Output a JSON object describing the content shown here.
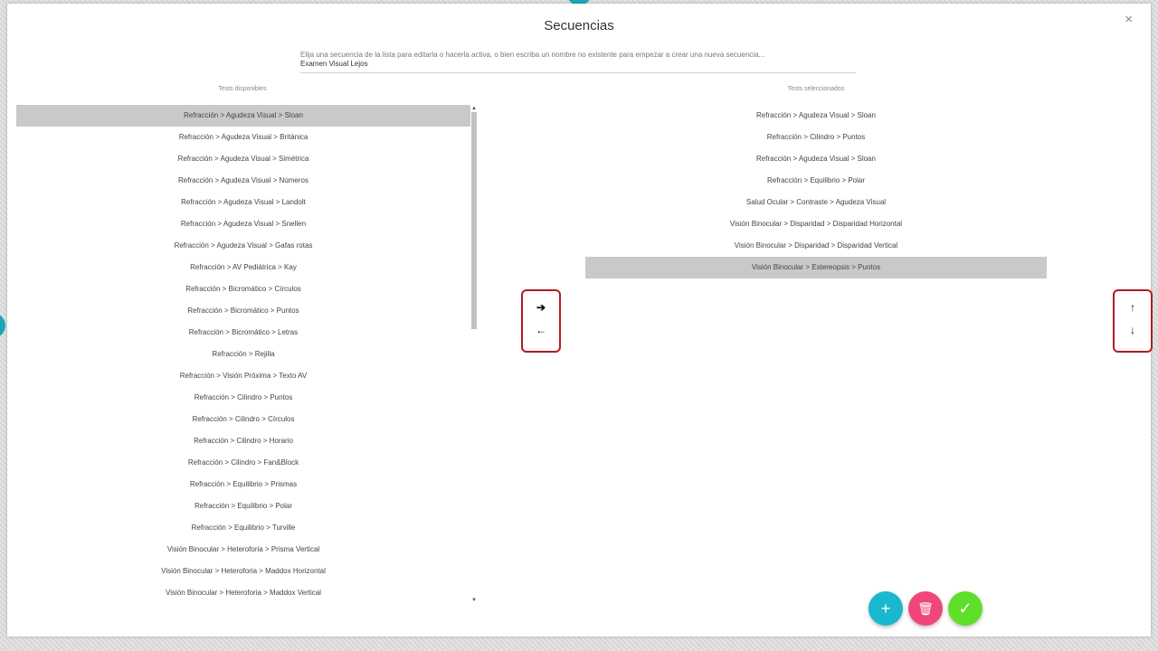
{
  "dialog": {
    "title": "Secuencias",
    "close_icon": "×"
  },
  "sequence": {
    "placeholder": "Elija una secuencia de la lista para editarla o hacerla activa, o bien escriba un nombre no existente para empezar a crear una nueva secuencia...",
    "value": "Examen Visual Lejos"
  },
  "available": {
    "label": "Tests disponibles",
    "selected_index": 0,
    "items": [
      "Refracción > Agudeza Visual > Sloan",
      "Refracción > Agudeza Visual > Británica",
      "Refracción > Agudeza Visual > Simétrica",
      "Refracción > Agudeza Visual > Números",
      "Refracción > Agudeza Visual > Landolt",
      "Refracción > Agudeza Visual > Snellen",
      "Refracción > Agudeza Visual > Gafas rotas",
      "Refracción > AV Pediátrica > Kay",
      "Refracción > Bicromático > Círculos",
      "Refracción > Bicromático > Puntos",
      "Refracción > Bicromático > Letras",
      "Refracción > Rejilla",
      "Refracción > Visión Próxima > Texto AV",
      "Refracción > Cilindro > Puntos",
      "Refracción > Cilindro > Círculos",
      "Refracción > Cilindro > Horario",
      "Refracción > Cilindro > Fan&Block",
      "Refracción > Equilibrio > Prismas",
      "Refracción > Equilibrio > Polar",
      "Refracción > Equilibrio > Turville",
      "Visión Binocular > Heteroforia > Prisma Vertical",
      "Visión Binocular > Heteroforia > Maddox Horizontal",
      "Visión Binocular > Heteroforia > Maddox Vertical"
    ]
  },
  "selected": {
    "label": "Tests seleccionados",
    "selected_index": 7,
    "items": [
      "Refracción > Agudeza Visual > Sloan",
      "Refracción > Cilindro > Puntos",
      "Refracción > Agudeza Visual > Sloan",
      "Refracción > Equilibrio > Polar",
      "Salud Ocular > Contraste > Agudeza Visual",
      "Visión Binocular > Disparidad > Disparidad Horizontal",
      "Visión Binocular > Disparidad > Disparidad Vertical",
      "Visión Binocular > Estereopsis > Puntos"
    ]
  },
  "transfer": {
    "add_icon": "➔",
    "remove_icon": "←"
  },
  "reorder": {
    "up_icon": "↑",
    "down_icon": "↓"
  },
  "scrollbar": {
    "up_icon": "▲",
    "down_icon": "▼"
  },
  "actions": {
    "new_icon": "+",
    "delete_icon": "🗑",
    "confirm_icon": "✓",
    "colors": {
      "new": "#1ab8cf",
      "delete": "#f0477a",
      "confirm": "#5ee02a"
    }
  }
}
